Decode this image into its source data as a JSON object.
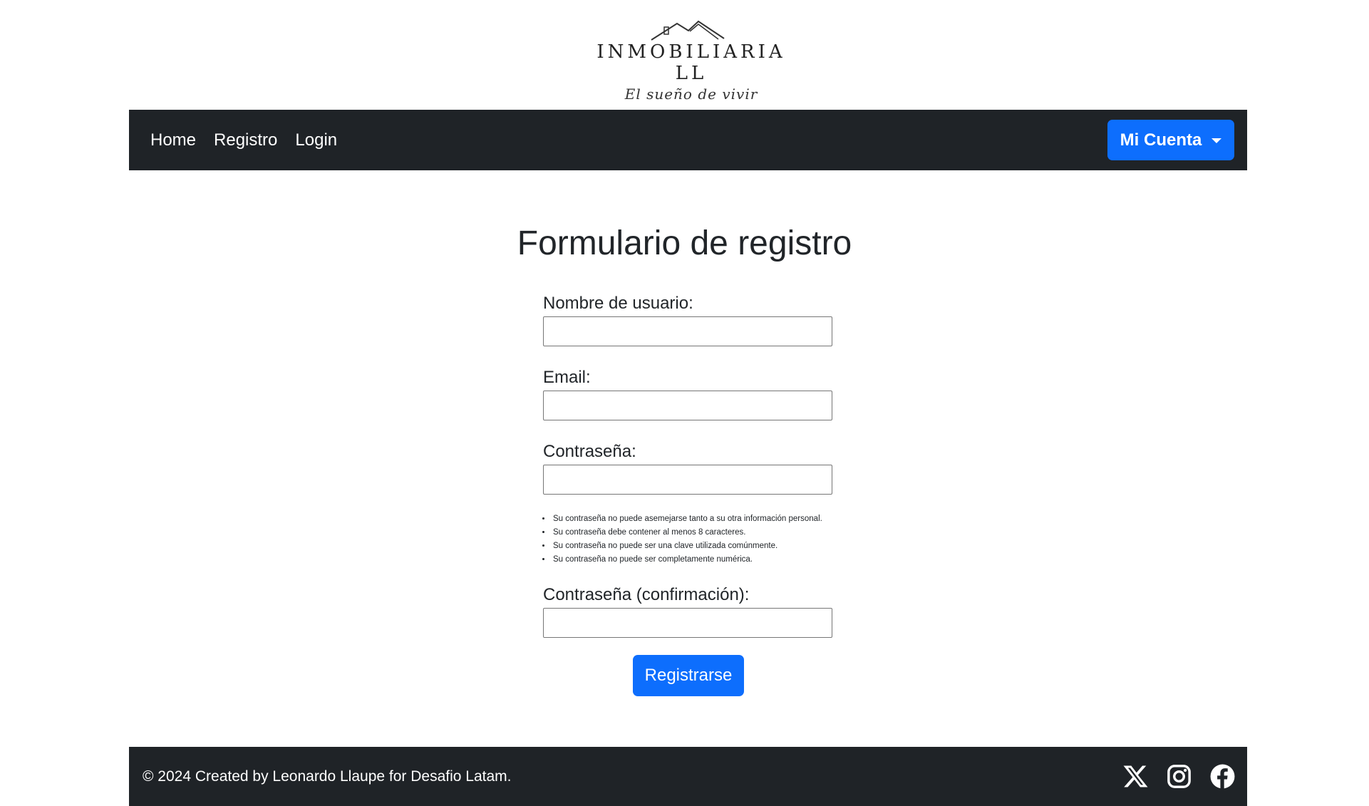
{
  "brand": {
    "name": "INMOBILIARIA LL",
    "tagline": "El sueño de vivir"
  },
  "navbar": {
    "links": [
      {
        "label": "Home"
      },
      {
        "label": "Registro"
      },
      {
        "label": "Login"
      }
    ],
    "account_button": "Mi Cuenta",
    "colors": {
      "background": "#1f2327",
      "accent": "#0d6efd"
    }
  },
  "form": {
    "title": "Formulario de registro",
    "fields": {
      "username": {
        "label": "Nombre de usuario:",
        "value": ""
      },
      "email": {
        "label": "Email:",
        "value": ""
      },
      "password": {
        "label": "Contraseña:",
        "value": ""
      },
      "password_confirm": {
        "label": "Contraseña (confirmación):",
        "value": ""
      }
    },
    "password_help": [
      "Su contraseña no puede asemejarse tanto a su otra información personal.",
      "Su contraseña debe contener al menos 8 caracteres.",
      "Su contraseña no puede ser una clave utilizada comúnmente.",
      "Su contraseña no puede ser completamente numérica."
    ],
    "submit_label": "Registrarse"
  },
  "footer": {
    "text": "© 2024 Created by Leonardo Llaupe for Desafio Latam.",
    "social_icons": [
      "x-icon",
      "instagram-icon",
      "facebook-icon"
    ]
  }
}
